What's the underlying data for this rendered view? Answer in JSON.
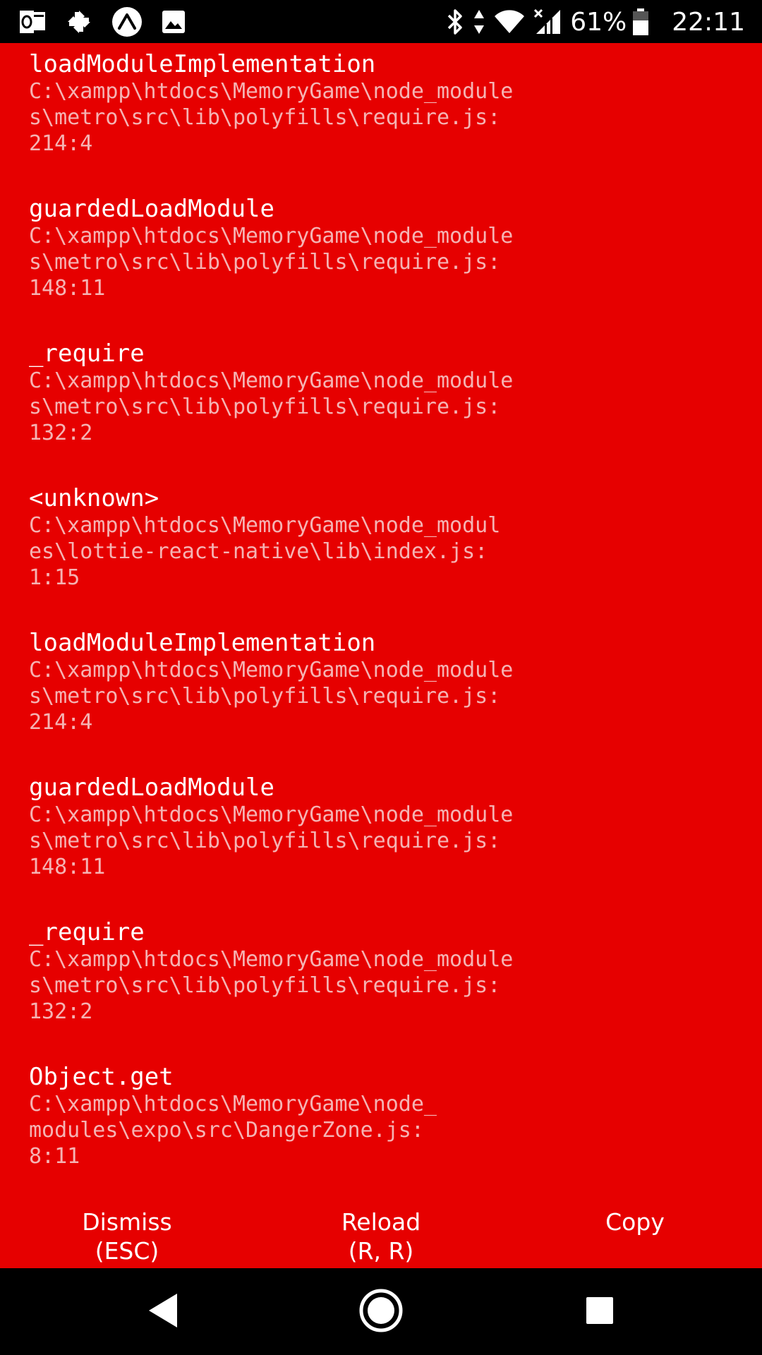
{
  "status_bar": {
    "left_icons": [
      "outlook-icon",
      "pinwheel-icon",
      "expo-icon",
      "image-icon"
    ],
    "right_icons": [
      "bluetooth-icon",
      "data-arrows-icon",
      "wifi-icon",
      "signal-icon",
      "battery-icon"
    ],
    "battery_percent": "61%",
    "time": "22:11"
  },
  "stack_frames": [
    {
      "method": "loadModuleImplementation",
      "file_lines": [
        "C:\\xampp\\htdocs\\MemoryGame\\node_module",
        "s\\metro\\src\\lib\\polyfills\\require.js:",
        "214:4"
      ]
    },
    {
      "method": "guardedLoadModule",
      "file_lines": [
        "C:\\xampp\\htdocs\\MemoryGame\\node_module",
        "s\\metro\\src\\lib\\polyfills\\require.js:",
        "148:11"
      ]
    },
    {
      "method": "_require",
      "file_lines": [
        "C:\\xampp\\htdocs\\MemoryGame\\node_module",
        "s\\metro\\src\\lib\\polyfills\\require.js:",
        "132:2"
      ]
    },
    {
      "method": "<unknown>",
      "file_lines": [
        "C:\\xampp\\htdocs\\MemoryGame\\node_modul",
        "es\\lottie-react-native\\lib\\index.js:",
        "1:15"
      ]
    },
    {
      "method": "loadModuleImplementation",
      "file_lines": [
        "C:\\xampp\\htdocs\\MemoryGame\\node_module",
        "s\\metro\\src\\lib\\polyfills\\require.js:",
        "214:4"
      ]
    },
    {
      "method": "guardedLoadModule",
      "file_lines": [
        "C:\\xampp\\htdocs\\MemoryGame\\node_module",
        "s\\metro\\src\\lib\\polyfills\\require.js:",
        "148:11"
      ]
    },
    {
      "method": "_require",
      "file_lines": [
        "C:\\xampp\\htdocs\\MemoryGame\\node_module",
        "s\\metro\\src\\lib\\polyfills\\require.js:",
        "132:2"
      ]
    },
    {
      "method": "Object.get",
      "file_lines": [
        "C:\\xampp\\htdocs\\MemoryGame\\node_",
        "modules\\expo\\src\\DangerZone.js:",
        "8:11"
      ]
    }
  ],
  "footer": {
    "dismiss": {
      "line1": "Dismiss",
      "line2": "(ESC)"
    },
    "reload": {
      "line1": "Reload",
      "line2": "(R, R)"
    },
    "copy": {
      "line1": "Copy"
    }
  },
  "nav_bar": {
    "icons": [
      "back-icon",
      "home-icon",
      "recents-icon"
    ]
  },
  "colors": {
    "error_background": "#e60000",
    "method_text": "#ffffff",
    "file_text": "#f5b3b3",
    "bars": "#000000"
  }
}
